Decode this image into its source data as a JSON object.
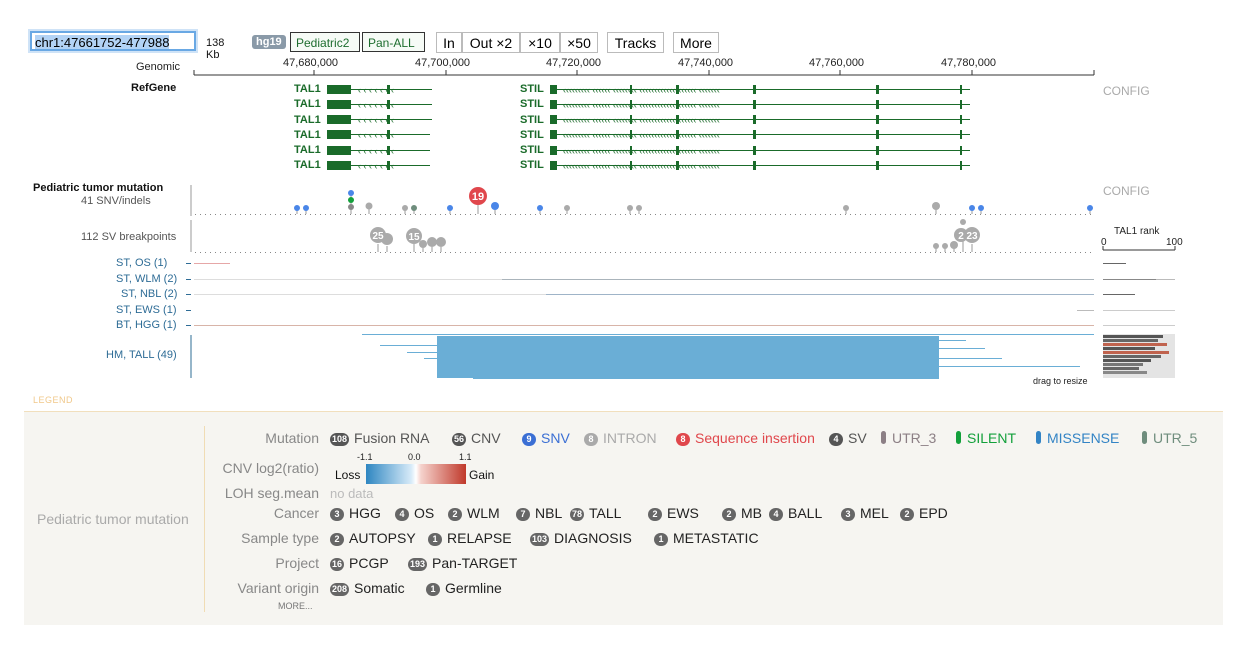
{
  "toolbar": {
    "coordinate": "chr1:47661752-477988",
    "size": "138 Kb",
    "genome": "hg19",
    "datasets": [
      "Pediatric2",
      "Pan-ALL"
    ],
    "zoom": [
      "In",
      "Out ×2",
      "×10",
      "×50"
    ],
    "tracks_label": "Tracks",
    "more_label": "More"
  },
  "ruler": {
    "label": "Genomic",
    "ticks": [
      "47,680,000",
      "47,700,000",
      "47,720,000",
      "47,740,000",
      "47,760,000",
      "47,780,000"
    ]
  },
  "refgene": {
    "label": "RefGene",
    "config": "CONFIG",
    "genes": [
      "TAL1",
      "TAL1",
      "TAL1",
      "TAL1",
      "TAL1",
      "TAL1",
      "STIL",
      "STIL",
      "STIL",
      "STIL",
      "STIL",
      "STIL"
    ]
  },
  "mutation_track": {
    "title": "Pediatric tumor mutation",
    "snv_label": "41 SNV/indels",
    "sv_label": "112 SV breakpoints",
    "config": "CONFIG",
    "snv_bubble": "19",
    "sv_bubbles": [
      "25",
      "15",
      "2",
      "23"
    ],
    "rank_title": "TAL1 rank",
    "rank_min": "0",
    "rank_max": "100",
    "samples": [
      "ST, OS (1)",
      "ST, WLM (2)",
      "ST, NBL (2)",
      "ST, EWS (1)",
      "BT, HGG (1)",
      "HM, TALL (49)"
    ],
    "drag_hint": "drag to resize"
  },
  "legend": {
    "header": "LEGEND",
    "track_name": "Pediatric tumor mutation",
    "mutation_label": "Mutation",
    "mutation_items": [
      {
        "badge": "108",
        "label": "Fusion RNA",
        "color": "#555555",
        "kind": "badge"
      },
      {
        "badge": "56",
        "label": "CNV",
        "color": "#555555",
        "kind": "badge"
      },
      {
        "badge": "9",
        "label": "SNV",
        "color": "#3b6fd4",
        "kind": "badge"
      },
      {
        "badge": "8",
        "label": "INTRON",
        "color": "#aaaaaa",
        "kind": "badge"
      },
      {
        "badge": "8",
        "label": "Sequence insertion",
        "color": "#e0474c",
        "kind": "badge"
      },
      {
        "badge": "4",
        "label": "SV",
        "color": "#555555",
        "kind": "badge"
      },
      {
        "badge": "",
        "label": "UTR_3",
        "color": "#8c7f85",
        "kind": "pill"
      },
      {
        "badge": "",
        "label": "SILENT",
        "color": "#13a03b",
        "kind": "pill"
      },
      {
        "badge": "",
        "label": "MISSENSE",
        "color": "#3384c5",
        "kind": "pill"
      },
      {
        "badge": "",
        "label": "UTR_5",
        "color": "#6f8d7d",
        "kind": "pill"
      }
    ],
    "cnv_label": "CNV log2(ratio)",
    "cnv_ticks": [
      "-1.1",
      "0.0",
      "1.1"
    ],
    "cnv_loss": "Loss",
    "cnv_gain": "Gain",
    "loh_label": "LOH seg.mean",
    "loh_value": "no data",
    "cancer_label": "Cancer",
    "cancer_items": [
      {
        "badge": "3",
        "label": "HGG"
      },
      {
        "badge": "4",
        "label": "OS"
      },
      {
        "badge": "2",
        "label": "WLM"
      },
      {
        "badge": "7",
        "label": "NBL"
      },
      {
        "badge": "78",
        "label": "TALL"
      },
      {
        "badge": "2",
        "label": "EWS"
      },
      {
        "badge": "2",
        "label": "MB"
      },
      {
        "badge": "4",
        "label": "BALL"
      },
      {
        "badge": "3",
        "label": "MEL"
      },
      {
        "badge": "2",
        "label": "EPD"
      }
    ],
    "sample_type_label": "Sample type",
    "sample_type_items": [
      {
        "badge": "2",
        "label": "AUTOPSY"
      },
      {
        "badge": "1",
        "label": "RELAPSE"
      },
      {
        "badge": "103",
        "label": "DIAGNOSIS"
      },
      {
        "badge": "1",
        "label": "METASTATIC"
      }
    ],
    "project_label": "Project",
    "project_items": [
      {
        "badge": "16",
        "label": "PCGP"
      },
      {
        "badge": "193",
        "label": "Pan-TARGET"
      }
    ],
    "origin_label": "Variant origin",
    "origin_items": [
      {
        "badge": "208",
        "label": "Somatic"
      },
      {
        "badge": "1",
        "label": "Germline"
      }
    ],
    "more": "MORE..."
  }
}
